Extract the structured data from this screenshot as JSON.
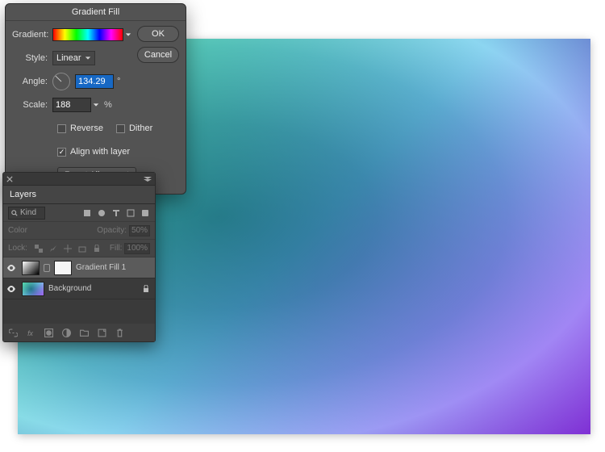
{
  "dialog": {
    "title": "Gradient Fill",
    "gradient_label": "Gradient:",
    "style_label": "Style:",
    "style_value": "Linear",
    "angle_label": "Angle:",
    "angle_value": "134.29",
    "angle_unit": "°",
    "scale_label": "Scale:",
    "scale_value": "188",
    "scale_unit": "%",
    "reverse_label": "Reverse",
    "reverse_checked": false,
    "dither_label": "Dither",
    "dither_checked": false,
    "align_label": "Align with layer",
    "align_checked": true,
    "reset_label": "Reset Alignment",
    "ok_label": "OK",
    "cancel_label": "Cancel"
  },
  "layers": {
    "tab_label": "Layers",
    "kind_label": "Kind",
    "blend_label": "Color",
    "opacity_label": "Opacity:",
    "opacity_value": "50%",
    "lock_label": "Lock:",
    "fill_label": "Fill:",
    "fill_value": "100%",
    "items": [
      {
        "name": "Gradient Fill 1",
        "visible": true,
        "selected": true,
        "locked": false,
        "type": "gradient"
      },
      {
        "name": "Background",
        "visible": true,
        "selected": false,
        "locked": true,
        "type": "photo"
      }
    ]
  },
  "colors": {
    "panel_bg": "#454545",
    "dialog_bg": "#535353",
    "select_blue": "#1768c4"
  }
}
